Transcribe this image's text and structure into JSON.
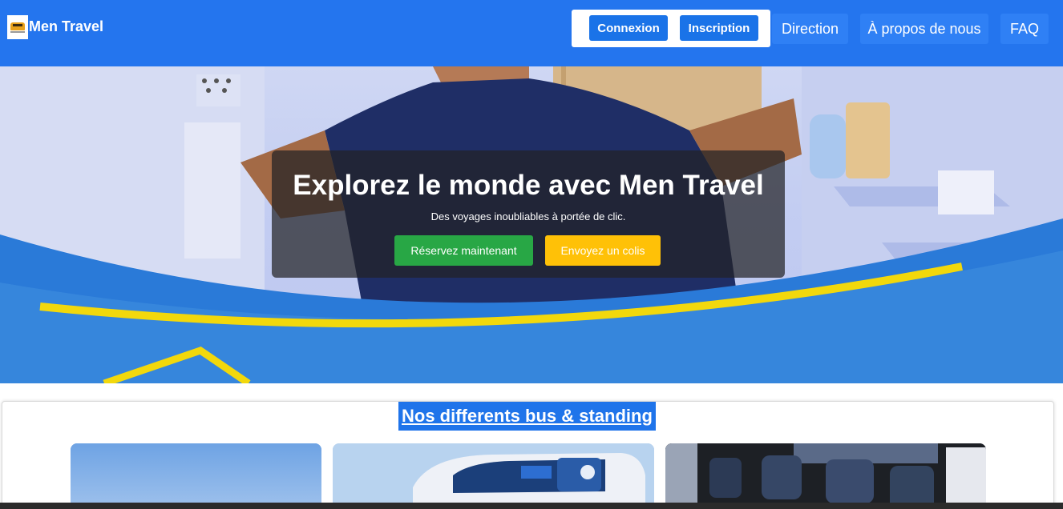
{
  "navbar": {
    "brand_name": "Men Travel",
    "login_label": "Connexion",
    "signup_label": "Inscription",
    "links": [
      "Direction",
      "À propos de nous",
      "FAQ"
    ]
  },
  "hero": {
    "title": "Explorez le monde avec Men Travel",
    "subtitle": "Des voyages inoubliables à portée de clic.",
    "book_label": "Réservez maintenant",
    "parcel_label": "Envoyez un colis"
  },
  "buses_section": {
    "title": "Nos differents bus & standing"
  },
  "colors": {
    "navbar": "#2475ee",
    "auth_button": "#1a73e8",
    "book_button": "#28a745",
    "parcel_button": "#ffc107",
    "section_title_bg": "#1f74ea"
  },
  "icons": {
    "brand_logo": "bus-logo-icon"
  }
}
